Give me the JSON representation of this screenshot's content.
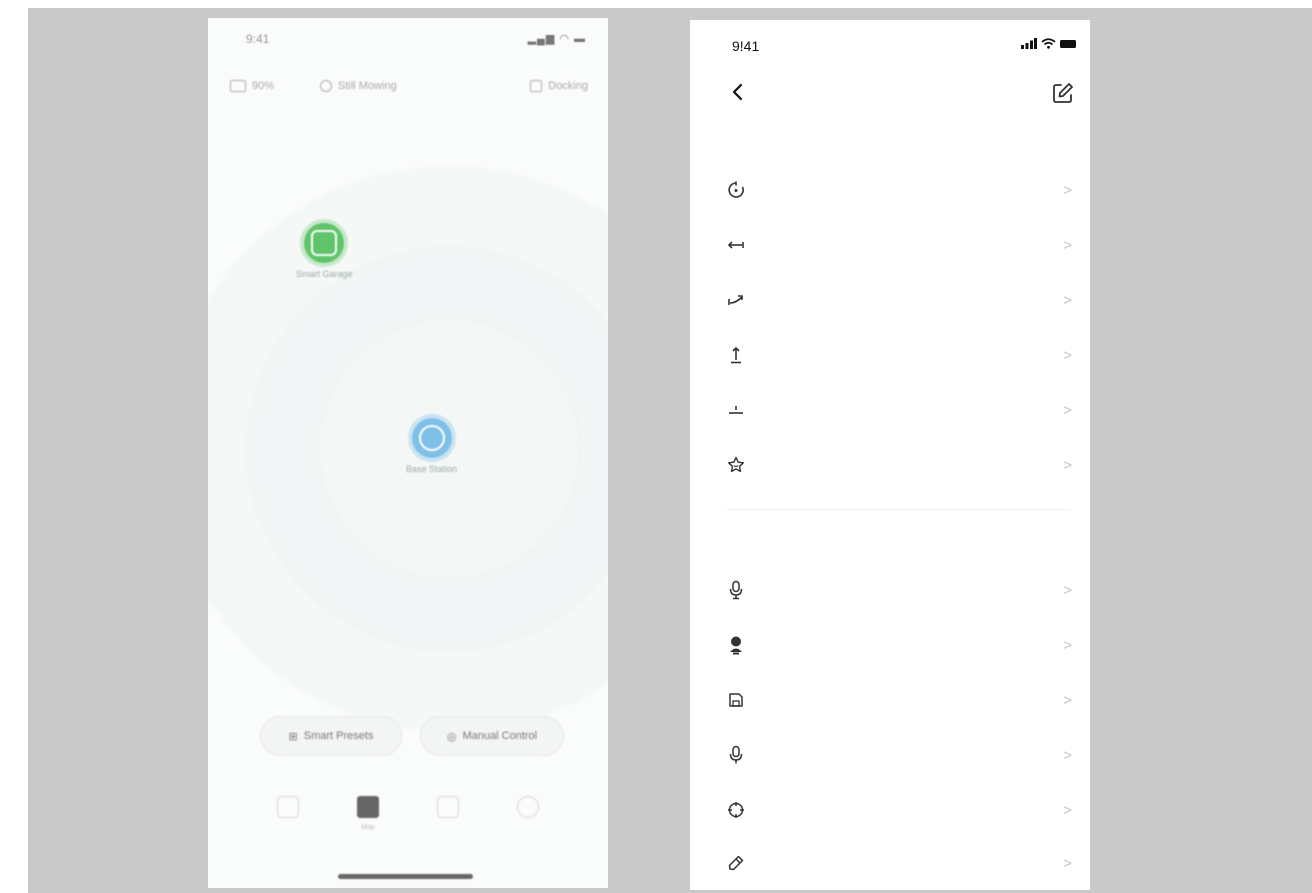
{
  "left_phone": {
    "status": {
      "time": "9:41"
    },
    "topbar": {
      "battery_label": "90%",
      "mode_label": "Still Mowing",
      "dock_label": "Docking"
    },
    "nodes": [
      {
        "label": "Smart Garage"
      },
      {
        "label": "Base Station"
      }
    ],
    "actions": {
      "left_label": "Smart Presets",
      "right_label": "Manual Control"
    },
    "tabs": [
      {
        "icon": "home-icon",
        "label": ""
      },
      {
        "icon": "grid-icon",
        "label": "Map"
      },
      {
        "icon": "list-icon",
        "label": ""
      },
      {
        "icon": "profile-icon",
        "label": ""
      }
    ]
  },
  "right_phone": {
    "status": {
      "time": "9!41"
    },
    "rows": [
      {
        "icon": "rotate-icon",
        "chevron": ">"
      },
      {
        "icon": "distance-icon",
        "chevron": ">"
      },
      {
        "icon": "path-icon",
        "chevron": ">"
      },
      {
        "icon": "arrow-up-icon",
        "chevron": ">"
      },
      {
        "icon": "height-icon",
        "chevron": ">"
      },
      {
        "icon": "star-icon",
        "chevron": ">"
      },
      {
        "icon": "microphone-icon",
        "chevron": ">"
      },
      {
        "icon": "user-icon",
        "chevron": ">"
      },
      {
        "icon": "save-icon",
        "chevron": ">"
      },
      {
        "icon": "microphone-icon",
        "chevron": ">"
      },
      {
        "icon": "crosshair-icon",
        "chevron": ">"
      },
      {
        "icon": "pen-icon",
        "chevron": ">"
      }
    ]
  },
  "colors": {
    "background": "#c9c9c9",
    "node_green": "#5fc46a",
    "node_blue": "#7ec0e8"
  }
}
